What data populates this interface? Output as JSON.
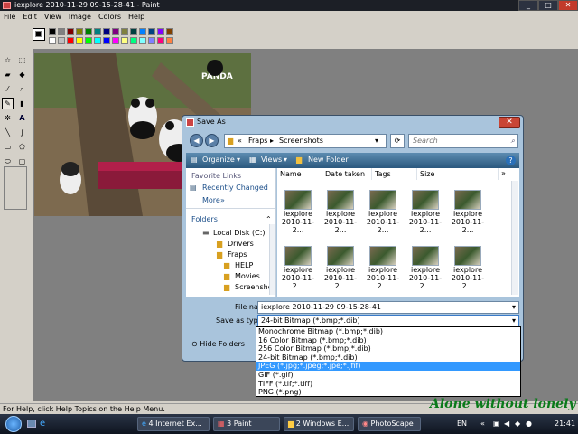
{
  "paint": {
    "title": "iexplore 2010-11-29 09-15-28-41 - Paint",
    "menu": [
      "File",
      "Edit",
      "View",
      "Image",
      "Colors",
      "Help"
    ],
    "status": "For Help, click Help Topics on the Help Menu.",
    "palette_colors": [
      "#000000",
      "#808080",
      "#800000",
      "#808000",
      "#008000",
      "#008080",
      "#000080",
      "#800080",
      "#808040",
      "#004040",
      "#0080ff",
      "#004080",
      "#8000ff",
      "#804000",
      "#ffffff",
      "#c0c0c0",
      "#ff0000",
      "#ffff00",
      "#00ff00",
      "#00ffff",
      "#0000ff",
      "#ff00ff",
      "#ffff80",
      "#00ff80",
      "#80ffff",
      "#8080ff",
      "#ff0080",
      "#ff8040"
    ],
    "image_watermark": "PANDA"
  },
  "dialog": {
    "title": "Save As",
    "breadcrumb_sep": "«",
    "crumb_1": "Fraps",
    "crumb_2": "Screenshots",
    "search_placeholder": "Search",
    "organize": "Organize",
    "views": "Views",
    "new_folder": "New Folder",
    "favorite_links": "Favorite Links",
    "recently_changed": "Recently Changed",
    "more": "More",
    "folders": "Folders",
    "tree": [
      "Local Disk (C:)",
      "Drivers",
      "Fraps",
      "HELP",
      "Movies",
      "Screenshot"
    ],
    "columns": [
      "Name",
      "Date taken",
      "Tags",
      "Size"
    ],
    "thumb_line1": "iexplore",
    "thumb_line2": "2010-11-2...",
    "file_name_label": "File name:",
    "file_name_value": "iexplore 2010-11-29 09-15-28-41",
    "save_type_label": "Save as type:",
    "save_type_value": "24-bit Bitmap (*.bmp;*.dib)",
    "hide_folders": "Hide Folders",
    "type_options": [
      "Monochrome Bitmap (*.bmp;*.dib)",
      "16 Color Bitmap (*.bmp;*.dib)",
      "256 Color Bitmap (*.bmp;*.dib)",
      "24-bit Bitmap (*.bmp;*.dib)",
      "JPEG (*.jpg;*.jpeg;*.jpe;*.jfif)",
      "GIF (*.gif)",
      "TIFF (*.tif;*.tiff)",
      "PNG (*.png)"
    ]
  },
  "overlay_text": "Alone without lonely",
  "taskbar": {
    "buttons": [
      "4 Internet Ex...",
      "3 Paint",
      "2 Windows E...",
      "PhotoScape"
    ],
    "lang": "EN",
    "clock": "21:41"
  }
}
